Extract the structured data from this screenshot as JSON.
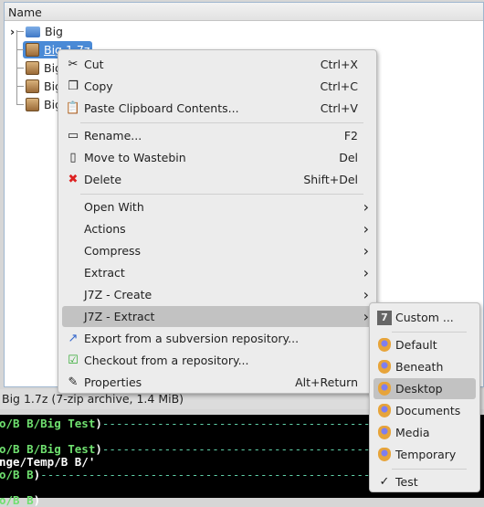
{
  "panel": {
    "header": "Name",
    "items": [
      {
        "label": "Big",
        "type": "folder"
      },
      {
        "label": "Big 1.7z",
        "type": "archive",
        "selected": true
      },
      {
        "label": "Big",
        "type": "archive"
      },
      {
        "label": "Big",
        "type": "archive"
      },
      {
        "label": "Big",
        "type": "archive"
      }
    ]
  },
  "status": "Big 1.7z (7-zip archive, 1.4 MiB)",
  "terminal": {
    "lines": [
      {
        "g": "o/B B/Big Test",
        "w": ")",
        "d": "--------------------------------------------------"
      },
      {
        "g": "",
        "w": "",
        "d": ""
      },
      {
        "g": "o/B B/Big Test",
        "w": ")",
        "d": "--------------------------------------------------"
      },
      {
        "g": "",
        "w": "nge/Temp/B B/'",
        "d": ""
      },
      {
        "g": "o/B B",
        "w": ")",
        "d": "------------------------------------------------------------"
      },
      {
        "g": "",
        "w": "",
        "d": ""
      },
      {
        "g": "o/B B",
        "w": ")",
        "d": ""
      }
    ]
  },
  "context_menu": {
    "items": [
      {
        "label": "Cut",
        "shortcut": "Ctrl+X",
        "icon": "scissors-icon"
      },
      {
        "label": "Copy",
        "shortcut": "Ctrl+C",
        "icon": "copy-icon"
      },
      {
        "label": "Paste Clipboard Contents...",
        "shortcut": "Ctrl+V",
        "icon": "paste-icon"
      },
      {
        "sep": true
      },
      {
        "label": "Rename...",
        "shortcut": "F2",
        "icon": "rename-icon"
      },
      {
        "label": "Move to Wastebin",
        "shortcut": "Del",
        "icon": "trash-icon"
      },
      {
        "label": "Delete",
        "shortcut": "Shift+Del",
        "icon": "delete-icon"
      },
      {
        "sep": true
      },
      {
        "label": "Open With",
        "submenu": true
      },
      {
        "label": "Actions",
        "submenu": true
      },
      {
        "label": "Compress",
        "submenu": true
      },
      {
        "label": "Extract",
        "submenu": true
      },
      {
        "label": "J7Z - Create",
        "submenu": true
      },
      {
        "label": "J7Z - Extract",
        "submenu": true,
        "highlighted": true
      },
      {
        "label": "Export from a subversion repository...",
        "icon": "svn-export-icon"
      },
      {
        "label": "Checkout from a repository...",
        "icon": "svn-checkout-icon"
      },
      {
        "label": "Properties",
        "shortcut": "Alt+Return",
        "icon": "properties-icon"
      }
    ]
  },
  "submenu": {
    "items": [
      {
        "label": "Custom ...",
        "icon": "7z-icon"
      },
      {
        "sep": true
      },
      {
        "label": "Default",
        "icon": "shield-icon"
      },
      {
        "label": "Beneath",
        "icon": "shield-icon"
      },
      {
        "label": "Desktop",
        "icon": "shield-icon",
        "highlighted": true
      },
      {
        "label": "Documents",
        "icon": "shield-icon"
      },
      {
        "label": "Media",
        "icon": "shield-icon"
      },
      {
        "label": "Temporary",
        "icon": "shield-icon"
      },
      {
        "sep": true
      },
      {
        "label": "Test",
        "icon": "check-icon",
        "checked": true
      }
    ]
  }
}
